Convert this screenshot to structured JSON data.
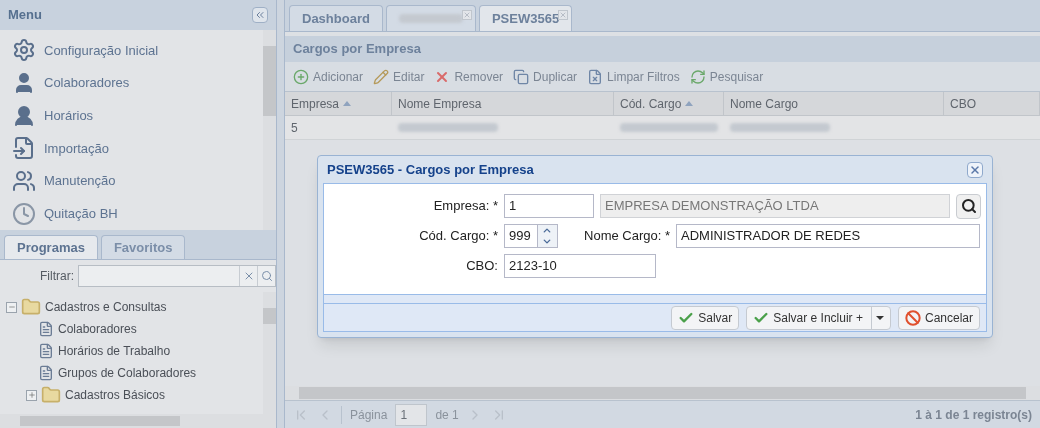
{
  "menu": {
    "title": "Menu",
    "items": [
      {
        "label": "Configuração Inicial"
      },
      {
        "label": "Colaboradores"
      },
      {
        "label": "Horários"
      },
      {
        "label": "Importação"
      },
      {
        "label": "Manutenção"
      },
      {
        "label": "Quitação BH"
      }
    ]
  },
  "side_tabs": [
    {
      "label": "Programas",
      "selected": true
    },
    {
      "label": "Favoritos",
      "selected": false
    }
  ],
  "filter": {
    "label": "Filtrar:"
  },
  "tree": [
    {
      "label": "Cadastros e Consultas",
      "kind": "folder",
      "expanded": true,
      "children": [
        {
          "label": "Colaboradores",
          "kind": "program"
        },
        {
          "label": "Horários de Trabalho",
          "kind": "program"
        },
        {
          "label": "Grupos de Colaboradores",
          "kind": "program"
        },
        {
          "label": "Cadastros Básicos",
          "kind": "folder",
          "expanded": false
        }
      ]
    }
  ],
  "tabs": [
    {
      "label": "Dashboard",
      "closable": false,
      "selected": false
    },
    {
      "closable": true,
      "selected": false
    },
    {
      "label": "PSEW3565",
      "closable": true,
      "selected": true
    }
  ],
  "panel": {
    "title": "Cargos por Empresa"
  },
  "toolbar": [
    {
      "label": "Adicionar"
    },
    {
      "label": "Editar"
    },
    {
      "label": "Remover"
    },
    {
      "label": "Duplicar"
    },
    {
      "label": "Limpar Filtros"
    },
    {
      "label": "Pesquisar"
    }
  ],
  "grid": {
    "columns": [
      {
        "label": "Empresa",
        "sorted": true
      },
      {
        "label": "Nome Empresa",
        "sorted": false
      },
      {
        "label": "Cód. Cargo",
        "sorted": true
      },
      {
        "label": "Nome Cargo",
        "sorted": false
      },
      {
        "label": "CBO",
        "sorted": false
      }
    ],
    "rows": [
      {
        "cells": [
          "5",
          null,
          null,
          null
        ]
      }
    ]
  },
  "paging": {
    "page_label": "Página",
    "page": "1",
    "of": "de 1",
    "summary": "1 à 1 de 1 registro(s)"
  },
  "dialog": {
    "title": "PSEW3565 - Cargos por Empresa",
    "empresa": {
      "label": "Empresa: *",
      "value": "1",
      "name": "EMPRESA DEMONSTRAÇÃO LTDA"
    },
    "cod_cargo": {
      "label": "Cód. Cargo: *",
      "value": "999"
    },
    "nome_cargo": {
      "label": "Nome Cargo: *",
      "value": "ADMINISTRADOR DE REDES"
    },
    "cbo": {
      "label": "CBO:",
      "value": "2123-10"
    },
    "buttons": [
      {
        "label": "Salvar",
        "kind": "confirm",
        "split": false
      },
      {
        "label": "Salvar e Incluir +",
        "kind": "confirm",
        "split": true
      },
      {
        "label": "Cancelar",
        "kind": "cancel",
        "split": false
      }
    ]
  }
}
